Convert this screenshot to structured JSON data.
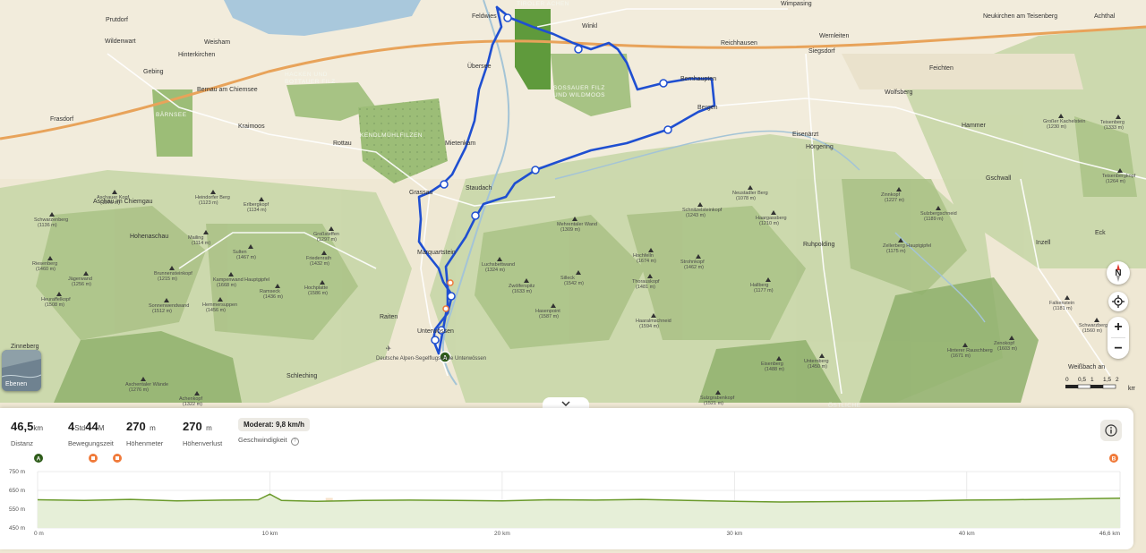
{
  "map": {
    "towns": [
      {
        "name": "Feldwies"
      },
      {
        "name": "Winkl"
      },
      {
        "name": "Wimpasing"
      },
      {
        "name": "Übersee"
      },
      {
        "name": "Bernhaupten"
      },
      {
        "name": "Reichhausen"
      },
      {
        "name": "Siegsdorf"
      },
      {
        "name": "Wernleiten"
      },
      {
        "name": "Neukirchen am Teisenberg"
      },
      {
        "name": "Achthal"
      },
      {
        "name": "Prutdorf"
      },
      {
        "name": "Wildenwart"
      },
      {
        "name": "Weisham"
      },
      {
        "name": "Hinterkirchen"
      },
      {
        "name": "Gebing"
      },
      {
        "name": "Bernau am Chiemsee"
      },
      {
        "name": "Frasdorf"
      },
      {
        "name": "Kraimoos"
      },
      {
        "name": "Rottau"
      },
      {
        "name": "Mietenkam"
      },
      {
        "name": "Grassau"
      },
      {
        "name": "Staudach"
      },
      {
        "name": "Bergen"
      },
      {
        "name": "Eisenärzt"
      },
      {
        "name": "Hörgering"
      },
      {
        "name": "Hammer"
      },
      {
        "name": "Wolfsberg"
      },
      {
        "name": "Gschwall"
      },
      {
        "name": "Aschau im Chiemgau"
      },
      {
        "name": "Hohenaschau"
      },
      {
        "name": "Marquartstein"
      },
      {
        "name": "Raiten"
      },
      {
        "name": "Unterwössen"
      },
      {
        "name": "Schleching"
      },
      {
        "name": "Ruhpolding"
      },
      {
        "name": "Inzell"
      },
      {
        "name": "Eck"
      },
      {
        "name": "Weißbach an"
      },
      {
        "name": "Zinneberg"
      },
      {
        "name": "Feichten"
      }
    ],
    "areas": [
      {
        "name": "TIROLER ACHEN"
      },
      {
        "name": "HACKEN UND BOTTAUER FILZ"
      },
      {
        "name": "SOSSAUER FILZ UND WILDMOOS"
      },
      {
        "name": "KENDLMÜHLFILZEN"
      },
      {
        "name": "BÄRNSEE"
      },
      {
        "name": "FEICHTEN"
      },
      {
        "name": "ÖSTLICHE"
      }
    ],
    "peaks": [
      {
        "name": "Aschauer Kopf",
        "elev": "(1076 m)"
      },
      {
        "name": "Heindorfer Berg",
        "elev": "(1123 m)"
      },
      {
        "name": "Erlbergkopf",
        "elev": "(1134 m)"
      },
      {
        "name": "Schwarzenberg",
        "elev": "(1136 m)"
      },
      {
        "name": "Riesenberg",
        "elev": "(1460 m)"
      },
      {
        "name": "Mailing",
        "elev": "(1114 m)"
      },
      {
        "name": "Sulten",
        "elev": "(1467 m)"
      },
      {
        "name": "Großsteffen",
        "elev": "(1297 m)"
      },
      {
        "name": "Friedenrath",
        "elev": "(1432 m)"
      },
      {
        "name": "Jägerwand",
        "elev": "(1256 m)"
      },
      {
        "name": "Brunnensteinkopf",
        "elev": "(1215 m)"
      },
      {
        "name": "Kampenwand Hauptgipfel",
        "elev": "(1668 m)"
      },
      {
        "name": "Ramseck",
        "elev": "(1436 m)"
      },
      {
        "name": "Hochplatte",
        "elev": "(1586 m)"
      },
      {
        "name": "Heuraffelkopf",
        "elev": "(1508 m)"
      },
      {
        "name": "Sonnenwendwand",
        "elev": "(1512 m)"
      },
      {
        "name": "Hemmersuppen",
        "elev": "(1456 m)"
      },
      {
        "name": "Aschentaler Wände",
        "elev": "(1276 m)"
      },
      {
        "name": "Achenkopf",
        "elev": "(1322 m)"
      },
      {
        "name": "Mehrentaler Wand",
        "elev": "(1309 m)"
      },
      {
        "name": "Luchsbettwand",
        "elev": "(1324 m)"
      },
      {
        "name": "Zwölferspitz",
        "elev": "(1633 m)"
      },
      {
        "name": "Silleck",
        "elev": "(1542 m)"
      },
      {
        "name": "Hasenpoint",
        "elev": "(1587 m)"
      },
      {
        "name": "Schnitzelsteinkopf",
        "elev": "(1243 m)"
      },
      {
        "name": "Neustadler Berg",
        "elev": "(1078 m)"
      },
      {
        "name": "Haargassberg",
        "elev": "(1210 m)"
      },
      {
        "name": "Hochfelln",
        "elev": "(1674 m)"
      },
      {
        "name": "Strohnkopf",
        "elev": "(1462 m)"
      },
      {
        "name": "Thorauskopf",
        "elev": "(1481 m)"
      },
      {
        "name": "Haaralmschneid",
        "elev": "(1594 m)"
      },
      {
        "name": "Hallberg",
        "elev": "(1177 m)"
      },
      {
        "name": "Eisenberg",
        "elev": "(1488 m)"
      },
      {
        "name": "Unternberg",
        "elev": "(1450 m)"
      },
      {
        "name": "Sulzgrabenkopf",
        "elev": "(1521 m)"
      },
      {
        "name": "Zinnkopf",
        "elev": "(1227 m)"
      },
      {
        "name": "Sulzbergschneid",
        "elev": "(1189 m)"
      },
      {
        "name": "Zellerberg Hauptgipfel",
        "elev": "(1175 m)"
      },
      {
        "name": "Großer Kachelstein",
        "elev": "(1230 m)"
      },
      {
        "name": "Teisenberg",
        "elev": "(1333 m)"
      },
      {
        "name": "Teisenbergkopf",
        "elev": "(1264 m)"
      },
      {
        "name": "Falkenstein",
        "elev": "(1181 m)"
      },
      {
        "name": "Hinterer Rauschberg",
        "elev": "(1671 m)"
      },
      {
        "name": "Zenokopf",
        "elev": "(1603 m)"
      },
      {
        "name": "Schwarzberg",
        "elev": "(1560 m)"
      }
    ],
    "poi": "Deutsche Alpen-Segelflugschule Unterwössen",
    "layers_label": "Ebenen",
    "compass_label": "N",
    "zoom_in": "+",
    "zoom_out": "−",
    "scale": {
      "ticks": [
        "0",
        "0,5",
        "1",
        "1,5",
        "2"
      ],
      "unit": "km"
    },
    "start_marker": "A"
  },
  "stats": {
    "distance": {
      "value": "46,5",
      "unit": "km",
      "label": "Distanz"
    },
    "moving_time": {
      "hours": "4",
      "h_unit": "Std",
      "minutes": "44",
      "m_unit": "M",
      "label": "Bewegungszeit"
    },
    "ascent": {
      "value": "270",
      "unit": "m",
      "label": "Höhenmeter"
    },
    "descent": {
      "value": "270",
      "unit": "m",
      "label": "Höhenverlust"
    },
    "speed": {
      "badge": "Moderat: 9,8 km/h",
      "label": "Geschwindigkeit"
    }
  },
  "profile": {
    "start_marker": "A",
    "end_marker": "B",
    "y_ticks": [
      "750 m",
      "650 m",
      "550 m",
      "450 m"
    ],
    "x_ticks": [
      "0 m",
      "10 km",
      "20 km",
      "30 km",
      "40 km",
      "46,6 km"
    ],
    "colors": {
      "line": "#6a9a2a",
      "fill": "#e6efd8",
      "route": "#1f4fd1",
      "poi": "#f07a3a"
    }
  },
  "chart_data": {
    "type": "area",
    "xlabel": "",
    "ylabel": "",
    "x_unit": "km",
    "y_unit": "m",
    "ylim": [
      450,
      750
    ],
    "xlim": [
      0,
      46.6
    ],
    "x": [
      0,
      2,
      4,
      6,
      8,
      9.5,
      10,
      10.5,
      12,
      14,
      16,
      18,
      20,
      22,
      24,
      26,
      28,
      30,
      32,
      34,
      36,
      38,
      40,
      42,
      44,
      46.6
    ],
    "y": [
      600,
      596,
      602,
      594,
      598,
      600,
      630,
      596,
      592,
      596,
      598,
      596,
      594,
      600,
      598,
      602,
      596,
      592,
      588,
      590,
      592,
      594,
      598,
      600,
      604,
      608
    ]
  }
}
